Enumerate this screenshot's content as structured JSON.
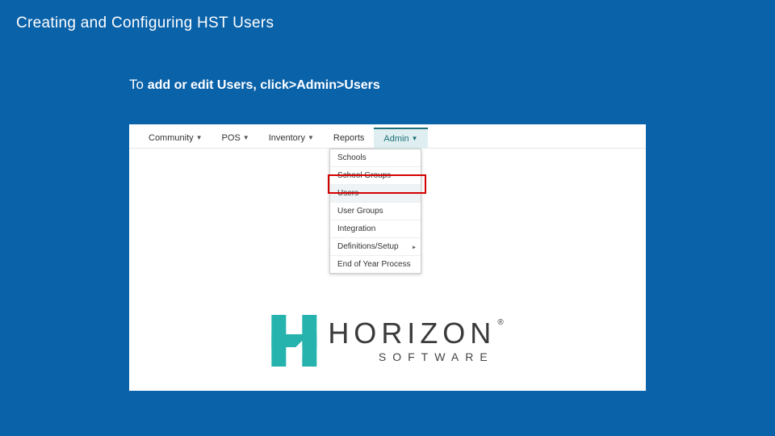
{
  "title": "Creating and Configuring HST Users",
  "caption_lead": "To ",
  "caption_rest": "add or edit Users, click>Admin>Users",
  "nav": {
    "items": [
      {
        "label": "Community",
        "has_caret": true
      },
      {
        "label": "POS",
        "has_caret": true
      },
      {
        "label": "Inventory",
        "has_caret": true
      },
      {
        "label": "Reports",
        "has_caret": false
      },
      {
        "label": "Admin",
        "has_caret": true
      }
    ]
  },
  "dropdown": {
    "items": [
      {
        "label": "Schools",
        "submenu": false,
        "highlighted": false
      },
      {
        "label": "School Groups",
        "submenu": false,
        "highlighted": false
      },
      {
        "label": "Users",
        "submenu": false,
        "highlighted": true
      },
      {
        "label": "User Groups",
        "submenu": false,
        "highlighted": false
      },
      {
        "label": "Integration",
        "submenu": false,
        "highlighted": false
      },
      {
        "label": "Definitions/Setup",
        "submenu": true,
        "highlighted": false
      },
      {
        "label": "End of Year Process",
        "submenu": false,
        "highlighted": false
      }
    ]
  },
  "logo": {
    "main": "HORIZON",
    "reg": "®",
    "sub": "SOFTWARE"
  }
}
